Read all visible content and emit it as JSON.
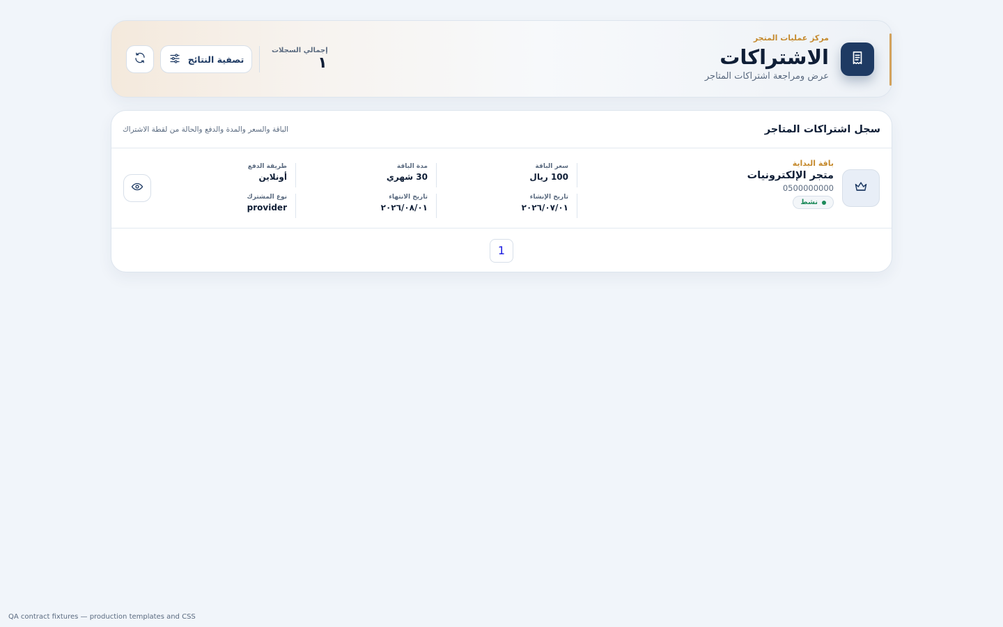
{
  "header": {
    "eyebrow": "مركز عمليات المتجر",
    "title": "الاشتراكات",
    "subtitle": "عرض ومراجعة اشتراكات المتاجر",
    "total_label": "إجمالي السجلات",
    "total_value": "١",
    "filter_label": "تصفية النتائج"
  },
  "card": {
    "title": "سجل اشتراكات المتاجر",
    "hint": "الباقة والسعر والمدة والدفع والحالة من لقطة الاشتراك"
  },
  "rows": [
    {
      "plan_name": "باقة البداية",
      "store_name": "متجر الإلكترونيات",
      "phone": "0500000000",
      "status": "نشط",
      "price_label": "سعر الباقة",
      "price_value": "100 ريال",
      "duration_label": "مدة الباقة",
      "duration_value": "30 شهري",
      "payment_label": "طريقة الدفع",
      "payment_value": "أونلاين",
      "created_label": "تاريخ الإنشاء",
      "created_value": "٢٠٢٦/٠٧/٠١",
      "end_label": "تاريخ الانتهاء",
      "end_value": "٢٠٢٦/٠٨/٠١",
      "subscriber_label": "نوع المشترك",
      "subscriber_value": "provider"
    }
  ],
  "pagination": {
    "current": "1"
  },
  "footer": {
    "note": "QA contract fixtures — production templates and CSS"
  },
  "colors": {
    "brand": "#1e3a63",
    "accent": "#c58a2e",
    "status_active": "#1d8a5a",
    "background": "#f1f5fa"
  },
  "icons": {
    "brand": "receipt-icon",
    "plan": "crown-icon",
    "filter": "sliders-icon",
    "refresh": "refresh-icon",
    "view": "eye-icon"
  }
}
